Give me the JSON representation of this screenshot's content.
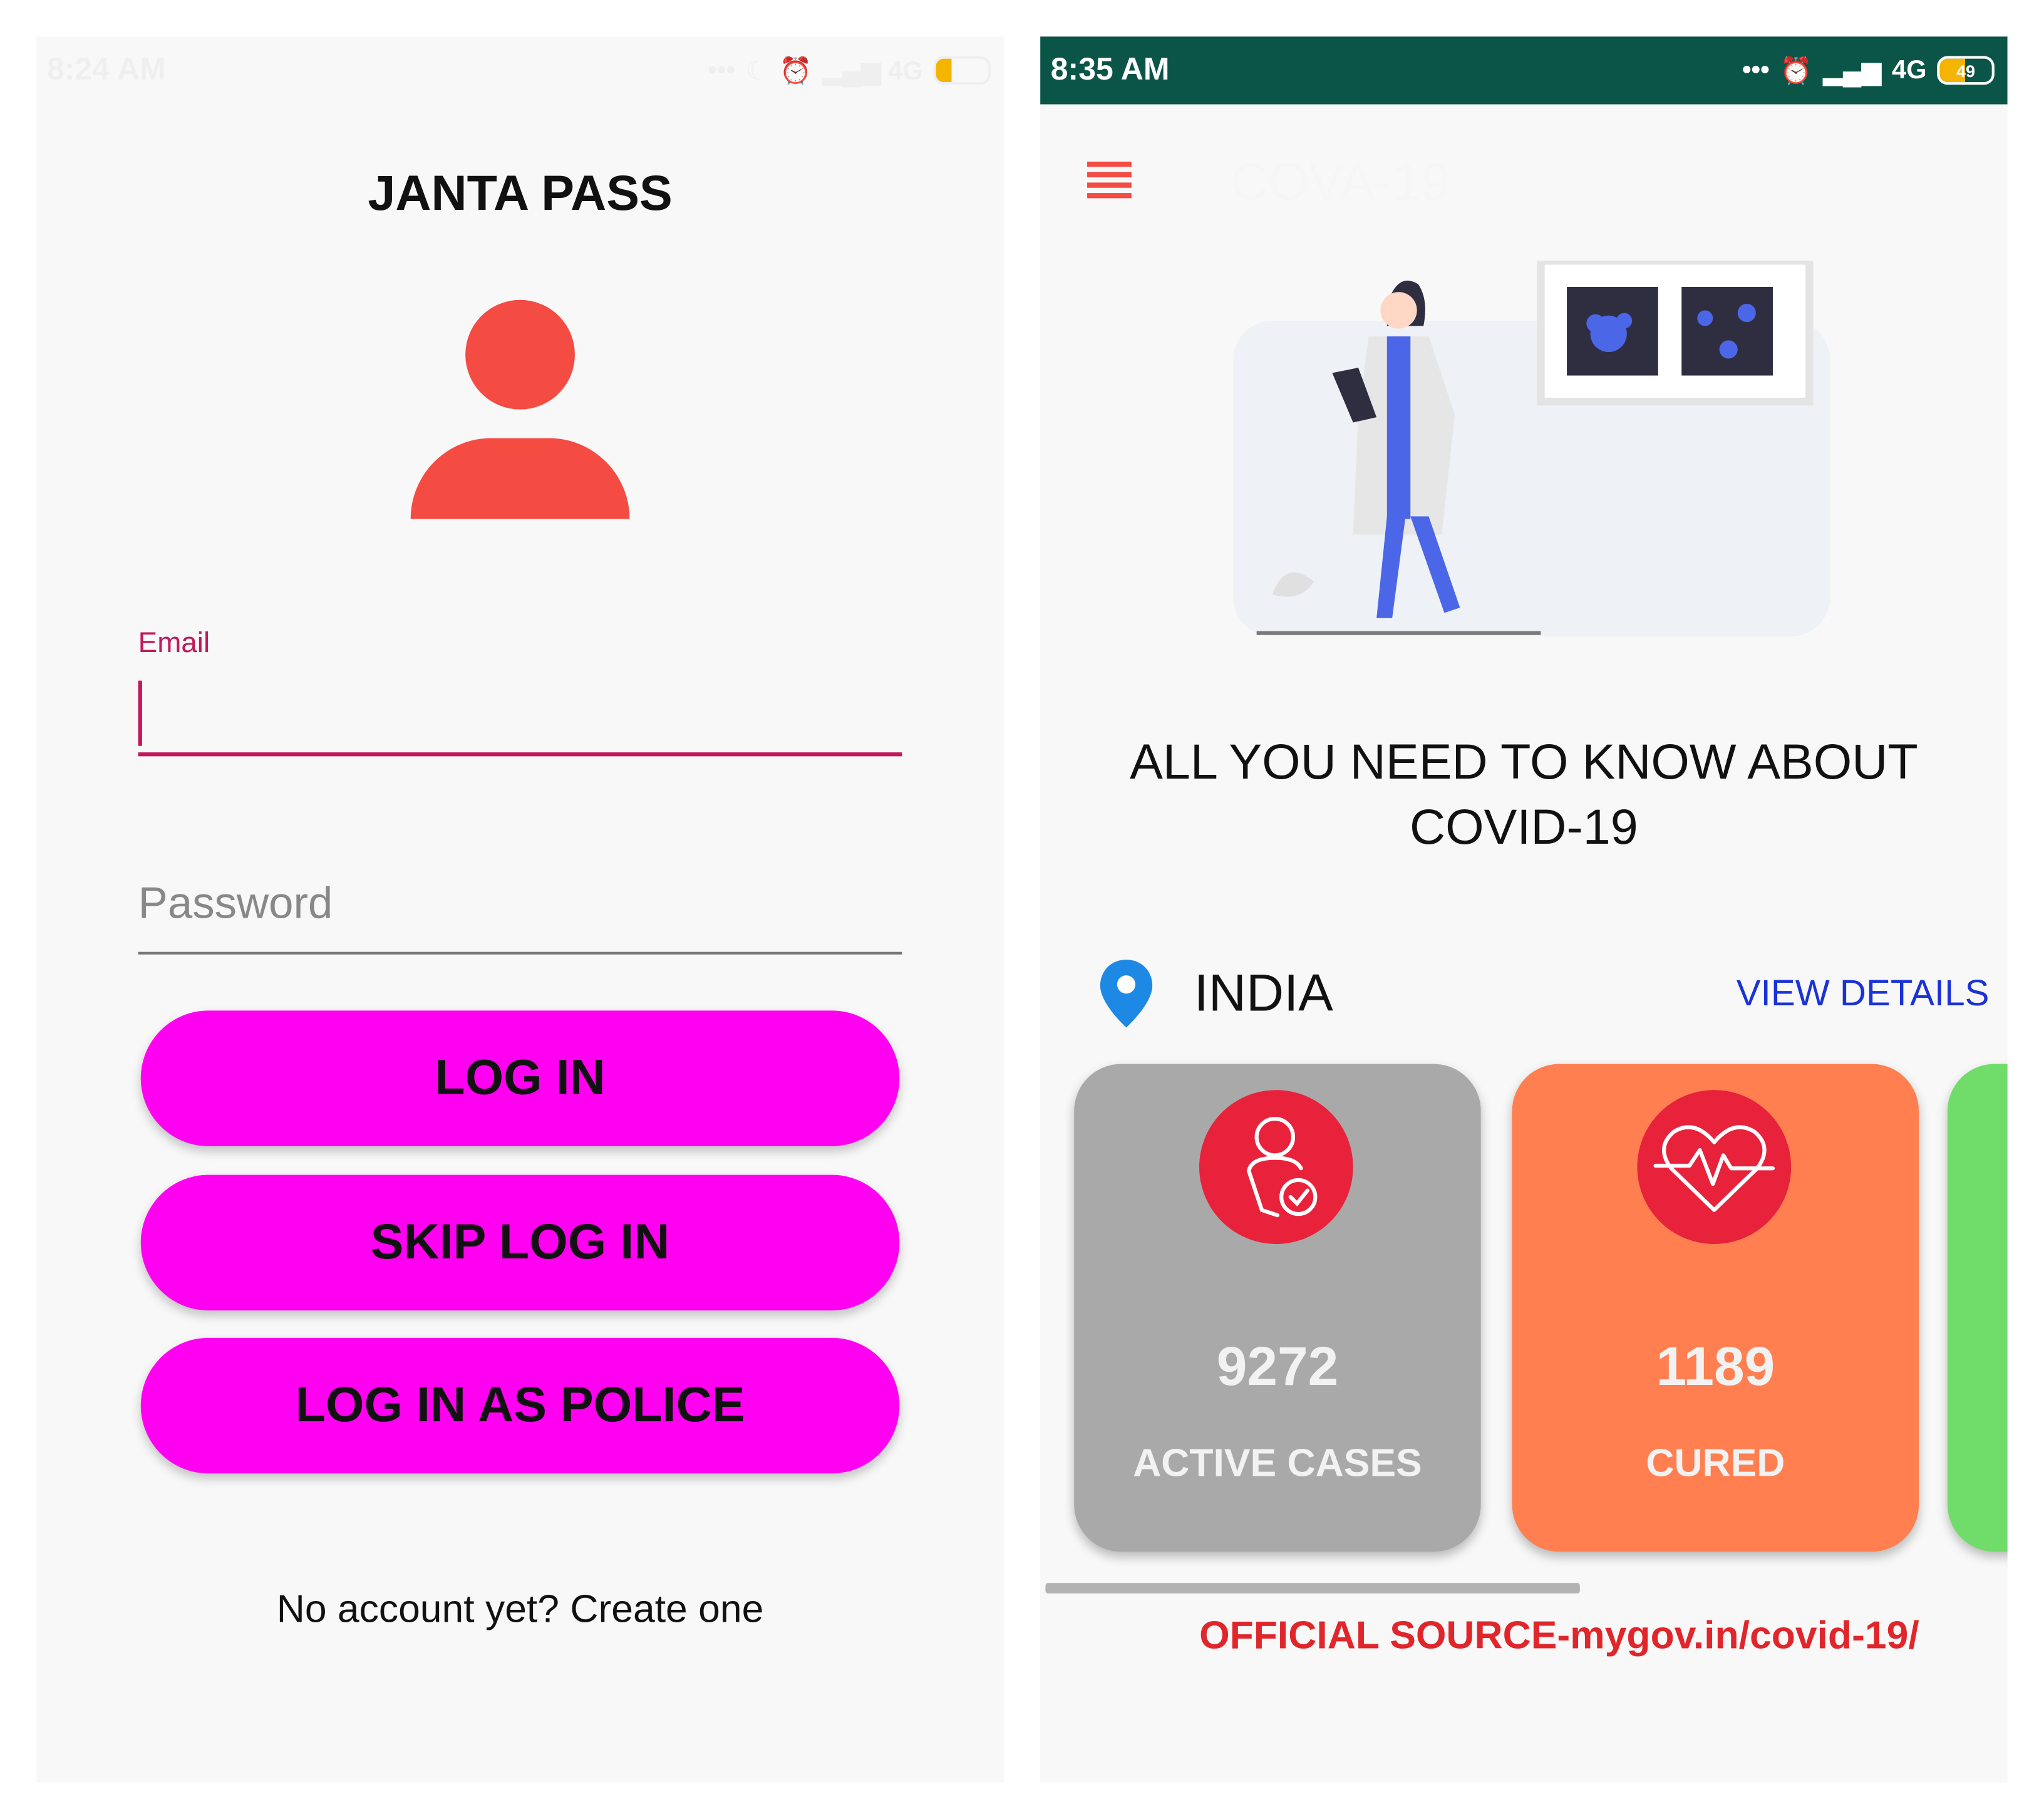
{
  "left_screen": {
    "status_time": "8:24 AM",
    "app_title": "JANTA PASS",
    "email_label": "Email",
    "email_value": "",
    "password_placeholder": "Password",
    "buttons": {
      "login": "LOG IN",
      "skip": "SKIP LOG IN",
      "police": "LOG IN AS POLICE"
    },
    "signup_link": "No account yet? Create one"
  },
  "right_screen": {
    "status_time": "8:35 AM",
    "network": "4G",
    "battery": "49",
    "toolbar_title": "COVA-19",
    "headline_line1": "ALL YOU NEED TO KNOW ABOUT",
    "headline_line2": "COVID-19",
    "region": "INDIA",
    "view_details": "VIEW DETAILS",
    "cards": [
      {
        "value": "9272",
        "label": "ACTIVE CASES",
        "color": "#a9a9a9"
      },
      {
        "value": "1189",
        "label": "CURED",
        "color": "#ff7f50"
      }
    ],
    "next_card_color": "#70dd6a",
    "source": "OFFICIAL SOURCE-mygov.in/covid-19/"
  },
  "colors": {
    "accent_red": "#f44b43",
    "button_magenta": "#ff00f0",
    "field_accent": "#c2185b",
    "status_bar_green": "#0b5548",
    "link_blue": "#1a32d6"
  }
}
